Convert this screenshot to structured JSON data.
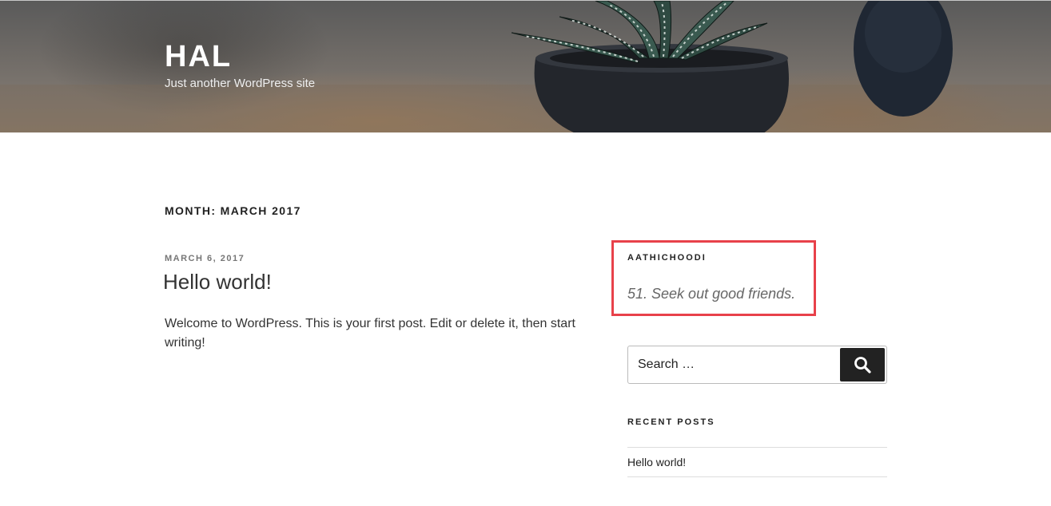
{
  "header": {
    "site_title": "HAL",
    "site_description": "Just another WordPress site"
  },
  "archive": {
    "page_title": "Month: March 2017"
  },
  "post": {
    "date": "March 6, 2017",
    "title": "Hello world!",
    "content": "Welcome to WordPress. This is your first post. Edit or delete it, then start writing!"
  },
  "sidebar": {
    "aathichoodi": {
      "title": "Aathichoodi",
      "quote": "51. Seek out good friends."
    },
    "search": {
      "placeholder": "Search …",
      "icon": "search-icon"
    },
    "recent_posts": {
      "title": "Recent Posts",
      "items": [
        {
          "label": "Hello world!"
        }
      ]
    }
  },
  "colors": {
    "highlight_border": "#e8414a",
    "search_button_bg": "#222222",
    "text": "#222222",
    "muted_text": "#767676"
  }
}
